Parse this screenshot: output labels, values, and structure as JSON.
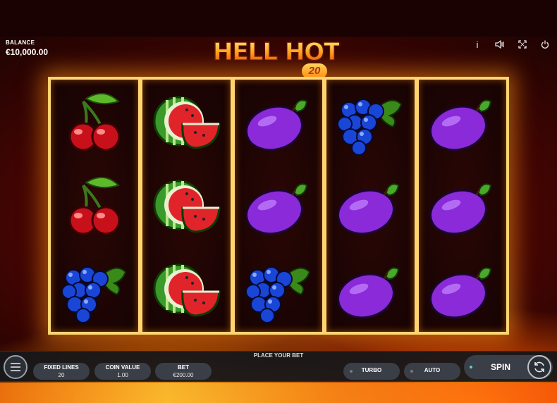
{
  "balance": {
    "label": "BALANCE",
    "value": "€10,000.00"
  },
  "logo": {
    "title": "HELL HOT",
    "badge": "20"
  },
  "top_icons": [
    "info-icon",
    "sound-icon",
    "fullscreen-icon",
    "power-icon"
  ],
  "info_label": "i",
  "reels": [
    [
      "cherry",
      "cherry",
      "grapes"
    ],
    [
      "watermelon",
      "watermelon",
      "watermelon"
    ],
    [
      "plum",
      "plum",
      "grapes"
    ],
    [
      "grapes",
      "plum",
      "plum"
    ],
    [
      "plum",
      "plum",
      "plum"
    ]
  ],
  "controls": {
    "place_bet": "PLACE YOUR BET",
    "fixed_lines_label": "FIXED LINES",
    "fixed_lines_value": "20",
    "coin_value_label": "COIN VALUE",
    "coin_value_value": "1.00",
    "bet_label": "BET",
    "bet_value": "€200.00",
    "turbo": "TURBO",
    "auto": "AUTO",
    "spin": "SPIN"
  },
  "colors": {
    "accent_gold": "#ffd36a",
    "bar_bg": "#14161a",
    "pill_bg": "#3a3e46"
  }
}
